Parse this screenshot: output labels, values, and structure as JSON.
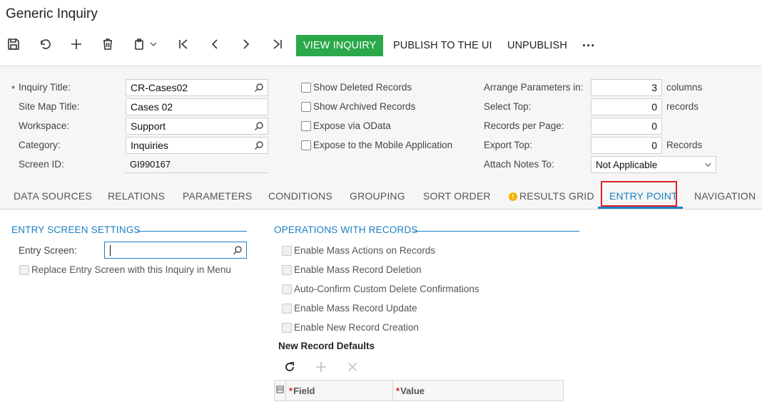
{
  "window": {
    "title": "Generic Inquiry"
  },
  "toolbar": {
    "view_inquiry": "VIEW INQUIRY",
    "publish": "PUBLISH TO THE UI",
    "unpublish": "UNPUBLISH",
    "more": "···",
    "primary_color": "#2aa84a"
  },
  "form": {
    "required_mark": "*",
    "inquiry_title_label": "Inquiry Title:",
    "inquiry_title_value": "CR-Cases02",
    "site_map_title_label": "Site Map Title:",
    "site_map_title_value": "Cases 02",
    "workspace_label": "Workspace:",
    "workspace_value": "Support",
    "category_label": "Category:",
    "category_value": "Inquiries",
    "screen_id_label": "Screen ID:",
    "screen_id_value": "GI990167",
    "show_deleted": "Show Deleted Records",
    "show_archived": "Show Archived Records",
    "expose_odata": "Expose via OData",
    "expose_mobile": "Expose to the Mobile Application",
    "arrange_label": "Arrange Parameters in:",
    "arrange_value": "3",
    "arrange_unit": "columns",
    "select_top_label": "Select Top:",
    "select_top_value": "0",
    "select_top_unit": "records",
    "records_per_page_label": "Records per Page:",
    "records_per_page_value": "0",
    "export_top_label": "Export Top:",
    "export_top_value": "0",
    "export_top_unit": "Records",
    "attach_notes_label": "Attach Notes To:",
    "attach_notes_value": "Not Applicable"
  },
  "tabs": [
    {
      "label": "DATA SOURCES"
    },
    {
      "label": "RELATIONS"
    },
    {
      "label": "PARAMETERS"
    },
    {
      "label": "CONDITIONS"
    },
    {
      "label": "GROUPING"
    },
    {
      "label": "SORT ORDER"
    },
    {
      "label": "RESULTS GRID"
    },
    {
      "label": "ENTRY POINT"
    },
    {
      "label": "NAVIGATION"
    }
  ],
  "warning_glyph": "!",
  "entry": {
    "section_title": "ENTRY SCREEN SETTINGS",
    "entry_screen_label": "Entry Screen:",
    "entry_screen_value": "",
    "replace_label": "Replace Entry Screen with this Inquiry in Menu"
  },
  "operations": {
    "section_title": "OPERATIONS WITH RECORDS",
    "mass_actions": "Enable Mass Actions on Records",
    "mass_deletion": "Enable Mass Record Deletion",
    "auto_confirm": "Auto-Confirm Custom Delete Confirmations",
    "mass_update": "Enable Mass Record Update",
    "new_record": "Enable New Record Creation",
    "defaults_title": "New Record Defaults",
    "grid_columns": [
      "Field",
      "Value"
    ]
  },
  "colors": {
    "accent": "#1a7fc1",
    "highlight": "#d9232d",
    "warning": "#f5b400"
  }
}
